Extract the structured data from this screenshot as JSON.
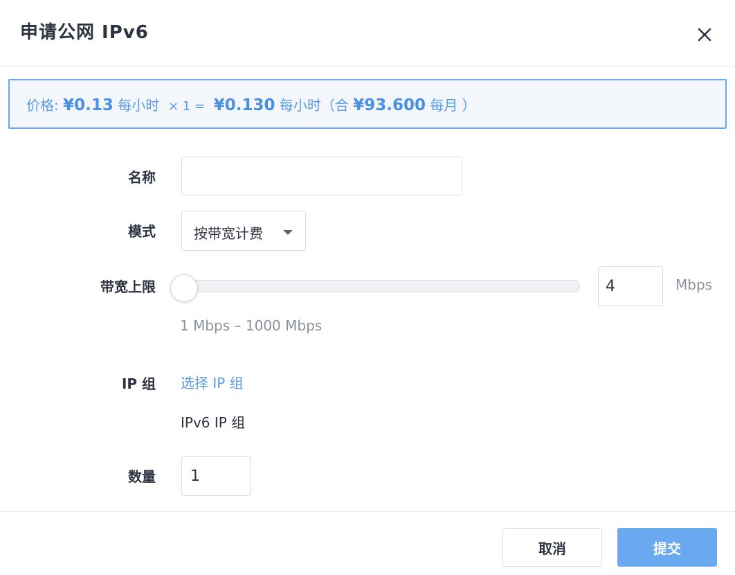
{
  "dialog": {
    "title": "申请公网 IPv6",
    "close_icon": "close-icon"
  },
  "price": {
    "label": "价格:",
    "unit_price": "¥0.13",
    "unit_period": "每小时",
    "multiplier": "× 1 =",
    "total": "¥0.130",
    "total_period": "每小时（合",
    "monthly": "¥93.600",
    "monthly_period": "每月 ）"
  },
  "form": {
    "name": {
      "label": "名称",
      "value": "",
      "placeholder": ""
    },
    "mode": {
      "label": "模式",
      "selected": "按带宽计费"
    },
    "bandwidth": {
      "label": "带宽上限",
      "value": "4",
      "unit": "Mbps",
      "range_hint": "1 Mbps – 1000 Mbps",
      "min": 1,
      "max": 1000
    },
    "ip_group": {
      "label": "IP 组",
      "link_text": "选择 IP 组",
      "value": "IPv6 IP 组"
    },
    "quantity": {
      "label": "数量",
      "value": "1"
    }
  },
  "footer": {
    "cancel_label": "取消",
    "submit_label": "提交"
  },
  "colors": {
    "accent": "#5a9be2",
    "primary_button": "#6aa8ef",
    "price_bar_bg": "#f3f7fc",
    "price_bar_border": "#6aa6ea"
  }
}
